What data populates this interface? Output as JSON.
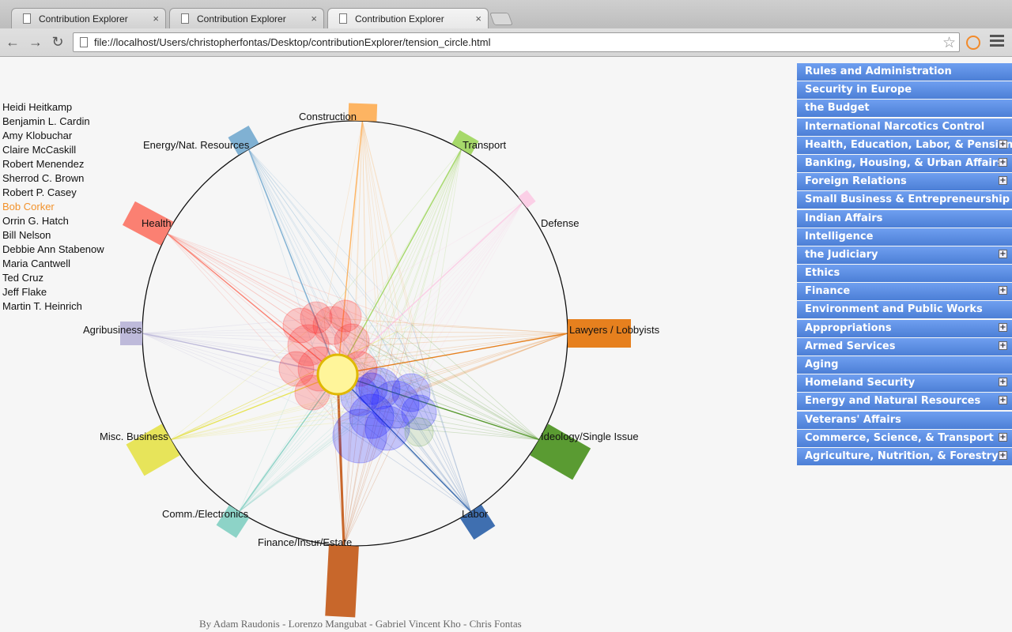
{
  "browser": {
    "tabs": [
      {
        "title": "Contribution Explorer",
        "active": false
      },
      {
        "title": "Contribution Explorer",
        "active": false
      },
      {
        "title": "Contribution Explorer",
        "active": true
      }
    ],
    "url": "file://localhost/Users/christopherfontas/Desktop/contributionExplorer/tension_circle.html"
  },
  "senators": [
    {
      "name": "Heidi Heitkamp",
      "selected": false
    },
    {
      "name": "Benjamin L. Cardin",
      "selected": false
    },
    {
      "name": "Amy Klobuchar",
      "selected": false
    },
    {
      "name": "Claire McCaskill",
      "selected": false
    },
    {
      "name": "Robert Menendez",
      "selected": false
    },
    {
      "name": "Sherrod C. Brown",
      "selected": false
    },
    {
      "name": "Robert P. Casey",
      "selected": false
    },
    {
      "name": "Bob Corker",
      "selected": true
    },
    {
      "name": "Orrin G. Hatch",
      "selected": false
    },
    {
      "name": "Bill Nelson",
      "selected": false
    },
    {
      "name": "Debbie Ann Stabenow",
      "selected": false
    },
    {
      "name": "Maria Cantwell",
      "selected": false
    },
    {
      "name": "Ted Cruz",
      "selected": false
    },
    {
      "name": "Jeff Flake",
      "selected": false
    },
    {
      "name": "Martin T. Heinrich",
      "selected": false
    }
  ],
  "industries": [
    {
      "name": "Construction",
      "color": "#fdb462"
    },
    {
      "name": "Transport",
      "color": "#a6d96a"
    },
    {
      "name": "Defense",
      "color": "#fbcfe6"
    },
    {
      "name": "Lawyers / Lobbyists",
      "color": "#e6801e"
    },
    {
      "name": "Ideology/Single Issue",
      "color": "#5a9b32"
    },
    {
      "name": "Labor",
      "color": "#3f6fb0"
    },
    {
      "name": "Finance/Insur/Estate",
      "color": "#c8672b"
    },
    {
      "name": "Comm./Electronics",
      "color": "#8dd3c7"
    },
    {
      "name": "Misc. Business",
      "color": "#e7e45a"
    },
    {
      "name": "Agribusiness",
      "color": "#bebada"
    },
    {
      "name": "Health",
      "color": "#fb8072"
    },
    {
      "name": "Energy/Nat. Resources",
      "color": "#80b1d3"
    }
  ],
  "committees": [
    {
      "name": "Rules and Administration",
      "expandable": false
    },
    {
      "name": "Security in Europe",
      "expandable": false
    },
    {
      "name": "the Budget",
      "expandable": false
    },
    {
      "name": "International Narcotics Control",
      "expandable": false
    },
    {
      "name": "Health, Education, Labor, & Pensions",
      "expandable": true
    },
    {
      "name": "Banking, Housing, & Urban Affairs",
      "expandable": true
    },
    {
      "name": "Foreign Relations",
      "expandable": true
    },
    {
      "name": "Small Business & Entrepreneurship",
      "expandable": false
    },
    {
      "name": "Indian Affairs",
      "expandable": false
    },
    {
      "name": "Intelligence",
      "expandable": false
    },
    {
      "name": "the Judiciary",
      "expandable": true
    },
    {
      "name": "Ethics",
      "expandable": false
    },
    {
      "name": "Finance",
      "expandable": true
    },
    {
      "name": "Environment and Public Works",
      "expandable": false
    },
    {
      "name": "Appropriations",
      "expandable": true
    },
    {
      "name": "Armed Services",
      "expandable": true
    },
    {
      "name": "Aging",
      "expandable": false
    },
    {
      "name": "Homeland Security",
      "expandable": true
    },
    {
      "name": "Energy and Natural Resources",
      "expandable": true
    },
    {
      "name": "Veterans' Affairs",
      "expandable": false
    },
    {
      "name": "Commerce, Science, & Transport",
      "expandable": true
    },
    {
      "name": "Agriculture, Nutrition, & Forestry",
      "expandable": true
    }
  ],
  "credits": "By Adam Raudonis - Lorenzo Mangubat - Gabriel Vincent Kho - Chris Fontas",
  "colors": {
    "democrat_cluster": "#1010ff",
    "republican_cluster": "#ff2020",
    "selected_senator": "#fff59a",
    "committee_blue": "#5b8ee3"
  }
}
